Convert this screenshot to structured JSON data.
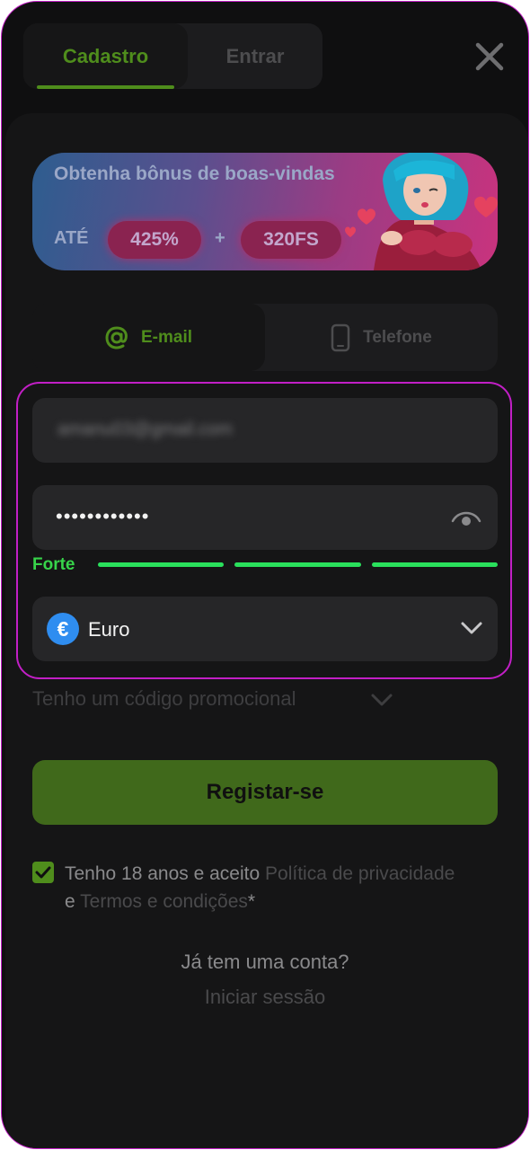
{
  "tabs": {
    "register": "Cadastro",
    "login": "Entrar"
  },
  "banner": {
    "title": "Obtenha bônus de boas-vindas",
    "upto": "ATÉ",
    "bonus_percent": "425%",
    "plus": "+",
    "free_spins": "320FS"
  },
  "method": {
    "email": "E-mail",
    "phone": "Telefone"
  },
  "form": {
    "email_value": "amanu03@gmail.com",
    "password_value": "••••••••••••",
    "strength_label": "Forte",
    "strength_level": 3,
    "strength_max": 3,
    "currency_symbol": "€",
    "currency": "Euro"
  },
  "promo": {
    "label": "Tenho um código promocional"
  },
  "register_button": "Registar-se",
  "terms": {
    "checked": true,
    "prefix": "Tenho 18 anos e aceito",
    "privacy": "Política de privacidade",
    "and": "e",
    "conditions": "Termos e condições",
    "asterisk": "*"
  },
  "footer": {
    "question": "Já tem uma conta?",
    "login_link": "Iniciar sessão"
  },
  "colors": {
    "accent": "#4f8d1c",
    "strength": "#2ae05c",
    "currency_icon": "#2f8df0",
    "highlight": "#c21fc6"
  }
}
